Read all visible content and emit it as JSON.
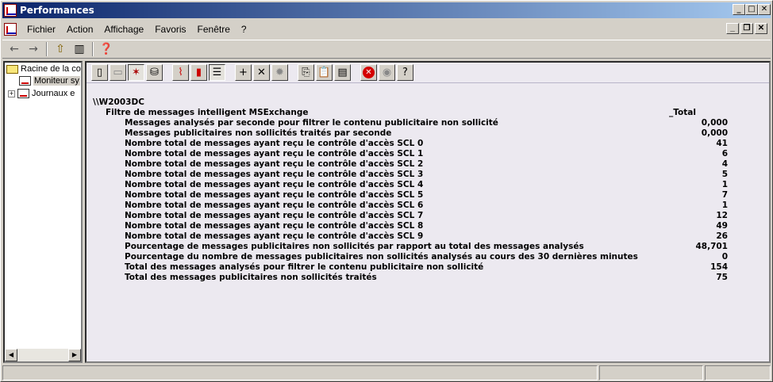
{
  "window": {
    "title": "Performances"
  },
  "menu": [
    {
      "label": "Fichier"
    },
    {
      "label": "Action"
    },
    {
      "label": "Affichage"
    },
    {
      "label": "Favoris"
    },
    {
      "label": "Fenêtre"
    },
    {
      "label": "?"
    }
  ],
  "tree": {
    "root": "Racine de la co",
    "items": [
      {
        "label": "Moniteur sy"
      },
      {
        "label": "Journaux e"
      }
    ]
  },
  "report": {
    "machine": "\\\\W2003DC",
    "object": "Filtre de messages intelligent MSExchange",
    "instance": "_Total",
    "counters": [
      {
        "name": "Messages analysés par seconde pour filtrer le contenu publicitaire non sollicité",
        "value": "0,000"
      },
      {
        "name": "Messages publicitaires non sollicités traités par seconde",
        "value": "0,000"
      },
      {
        "name": "Nombre total de messages ayant reçu le contrôle d'accès SCL 0",
        "value": "41"
      },
      {
        "name": "Nombre total de messages ayant reçu le contrôle d'accès SCL 1",
        "value": "6"
      },
      {
        "name": "Nombre total de messages ayant reçu le contrôle d'accès SCL 2",
        "value": "4"
      },
      {
        "name": "Nombre total de messages ayant reçu le contrôle d'accès SCL 3",
        "value": "5"
      },
      {
        "name": "Nombre total de messages ayant reçu le contrôle d'accès SCL 4",
        "value": "1"
      },
      {
        "name": "Nombre total de messages ayant reçu le contrôle d'accès SCL 5",
        "value": "7"
      },
      {
        "name": "Nombre total de messages ayant reçu le contrôle d'accès SCL 6",
        "value": "1"
      },
      {
        "name": "Nombre total de messages ayant reçu le contrôle d'accès SCL 7",
        "value": "12"
      },
      {
        "name": "Nombre total de messages ayant reçu le contrôle d'accès SCL 8",
        "value": "49"
      },
      {
        "name": "Nombre total de messages ayant reçu le contrôle d'accès SCL 9",
        "value": "26"
      },
      {
        "name": "Pourcentage de messages publicitaires non sollicités par rapport au total des messages analysés",
        "value": "48,701"
      },
      {
        "name": "Pourcentage du nombre de messages publicitaires non sollicités analysés au cours des 30 dernières minutes",
        "value": "0"
      },
      {
        "name": "Total des messages analysés pour filtrer le contenu publicitaire non sollicité",
        "value": "154"
      },
      {
        "name": "Total des messages publicitaires non sollicités traités",
        "value": "75"
      }
    ]
  }
}
